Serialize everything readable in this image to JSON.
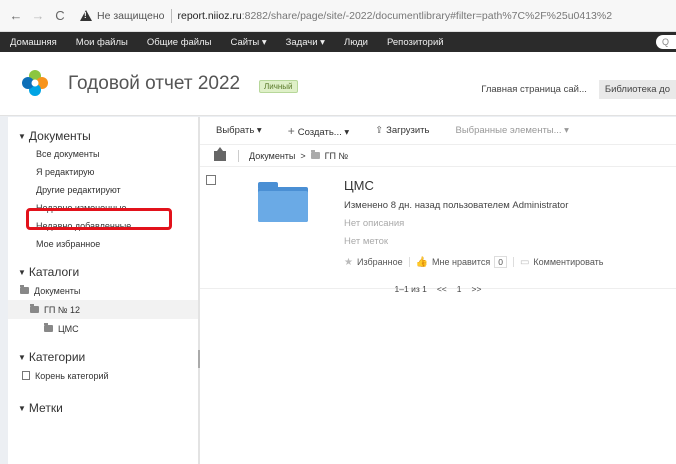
{
  "browser": {
    "back": "←",
    "forward": "→",
    "reload": "C",
    "security_text": "Не защищено",
    "url_host": "report.niioz.ru",
    "url_rest": ":8282/share/page/site/-2022/documentlibrary#filter=path%7C%2F%25u0413%2"
  },
  "topmenu": {
    "items": [
      "Домашняя",
      "Мои файлы",
      "Общие файлы",
      "Сайты ▾",
      "Задачи ▾",
      "Люди",
      "Репозиторий"
    ],
    "search_placeholder": "Q"
  },
  "site": {
    "title": "Годовой отчет 2022",
    "badge": "Личный",
    "nav": [
      "Главная страница сай...",
      "Библиотека до"
    ]
  },
  "sidebar": {
    "documents_header": "Документы",
    "filters": [
      "Все документы",
      "Я редактирую",
      "Другие редактируют",
      "Недавно измененные",
      "Недавно добавленные",
      "Мое избранное"
    ],
    "catalogs_header": "Каталоги",
    "tree": [
      "Документы",
      "ГП № 12",
      "ЦМС"
    ],
    "categories_header": "Категории",
    "category_root": "Корень категорий",
    "tags_header": "Метки"
  },
  "toolbar": {
    "select": "Выбрать ▾",
    "create": "Создать... ▾",
    "upload": "Загрузить",
    "selected": "Выбранные элементы... ▾"
  },
  "breadcrumb": {
    "root": "Документы",
    "sep": ">",
    "current": "ГП №"
  },
  "item": {
    "name": "ЦМС",
    "modified": "Изменено 8 дн. назад пользователем Administrator",
    "description": "Нет описания",
    "tags": "Нет меток",
    "favorite": "Избранное",
    "like": "Мне нравится",
    "like_count": "0",
    "comment": "Комментировать"
  },
  "pager": {
    "range": "1–1 из 1",
    "prev": "<<",
    "page": "1",
    "next": ">>"
  },
  "colors": {
    "highlight": "#e2121b",
    "folder": "#4a8fd4",
    "menu_bg": "#2b2b2b"
  }
}
